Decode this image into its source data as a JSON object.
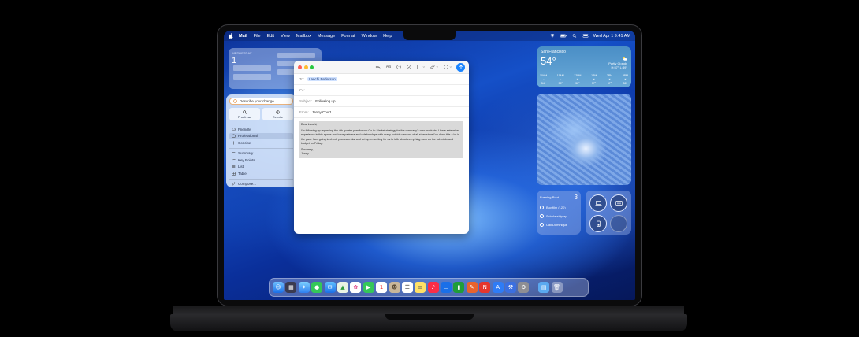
{
  "menubar": {
    "app_name": "Mail",
    "menus": [
      "File",
      "Edit",
      "View",
      "Mailbox",
      "Message",
      "Format",
      "Window",
      "Help"
    ],
    "datetime": "Wed Apr 1  9:41 AM"
  },
  "calendar_widget": {
    "weekday": "WEDNESDAY",
    "day_number": "1"
  },
  "writing_tools": {
    "describe_placeholder": "Describe your change",
    "proofread_label": "Proofread",
    "rewrite_label": "Rewrite",
    "tones": [
      "Friendly",
      "Professional",
      "Concise"
    ],
    "selected_tone": "Professional",
    "formats": [
      "Summary",
      "Key Points",
      "List",
      "Table"
    ],
    "compose_label": "Compose..."
  },
  "mail": {
    "to_label": "To:",
    "to_value": "Lanchi Pederson",
    "cc_label": "Cc:",
    "subject_label": "Subject:",
    "subject_value": "Following up",
    "from_label": "From:",
    "from_value": "Jenny Court",
    "body_greeting": "Dear Lanchi,",
    "body_text": "I'm following up regarding the 4th quarter plan for our Go-to-Market strategy for the company's new products. I have extensive experience in this space and have partners and relationships with many outside vendors of all sizes since I've done this a lot in the past. I am going to check your calendar and set up a meeting for us to talk about everything such as the schedule and budget on Friday.",
    "body_signoff": "Sincerely,",
    "body_name": "Jenny"
  },
  "weather": {
    "city": "San Francisco",
    "temperature": "54°",
    "condition": "Partly Cloudy",
    "hi_lo": "H:57° L:49°",
    "forecast": [
      {
        "time": "10AM",
        "temp": "54°"
      },
      {
        "time": "11AM",
        "temp": "55°"
      },
      {
        "time": "12PM",
        "temp": "56°"
      },
      {
        "time": "1PM",
        "temp": "57°"
      },
      {
        "time": "2PM",
        "temp": "57°"
      },
      {
        "time": "3PM",
        "temp": "56°"
      }
    ]
  },
  "reminders": {
    "title": "Evening Rout...",
    "count": "3",
    "items": [
      "Buy film (120)",
      "Scholarship ap...",
      "Call Dominique"
    ]
  },
  "colors": {
    "accent": "#1a84ff",
    "selection_chip": "#cfe1ff"
  }
}
